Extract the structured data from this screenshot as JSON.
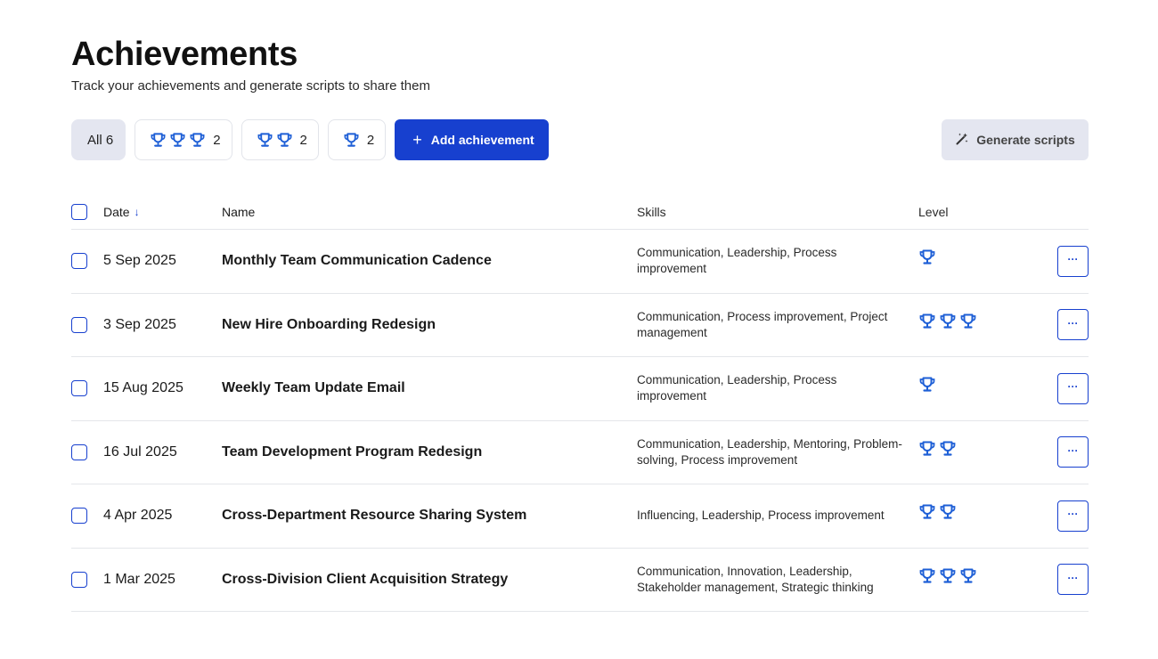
{
  "header": {
    "title": "Achievements",
    "subtitle": "Track your achievements and generate scripts to share them"
  },
  "filters": {
    "all_label": "All 6",
    "three_count": "2",
    "two_count": "2",
    "one_count": "2",
    "trophy_icon": "trophy-icon"
  },
  "actions": {
    "add_label": "Add achievement",
    "add_icon": "+",
    "generate_label": "Generate scripts",
    "generate_icon": "magic-wand-icon"
  },
  "table": {
    "headers": {
      "date": "Date",
      "name": "Name",
      "skills": "Skills",
      "level": "Level"
    },
    "sort_icon": "↓",
    "more_label": "···",
    "rows": [
      {
        "date": "5 Sep 2025",
        "name": "Monthly Team Communication Cadence",
        "skills": "Communication, Leadership, Process improvement",
        "level": 1
      },
      {
        "date": "3 Sep 2025",
        "name": "New Hire Onboarding Redesign",
        "skills": "Communication, Process improvement, Project management",
        "level": 3
      },
      {
        "date": "15 Aug 2025",
        "name": "Weekly Team Update Email",
        "skills": "Communication, Leadership, Process improvement",
        "level": 1
      },
      {
        "date": "16 Jul 2025",
        "name": "Team Development Program Redesign",
        "skills": "Communication, Leadership, Mentoring, Problem-solving, Process improvement",
        "level": 2
      },
      {
        "date": "4 Apr 2025",
        "name": "Cross-Department Resource Sharing System",
        "skills": "Influencing, Leadership, Process improvement",
        "level": 2
      },
      {
        "date": "1 Mar 2025",
        "name": "Cross-Division Client Acquisition Strategy",
        "skills": "Communication, Innovation, Leadership, Stakeholder management, Strategic thinking",
        "level": 3
      }
    ]
  },
  "colors": {
    "accent": "#1740cf",
    "trophy": "#1e5fd6",
    "chip_active_bg": "#e4e6f0",
    "border": "#e4e6ea"
  }
}
